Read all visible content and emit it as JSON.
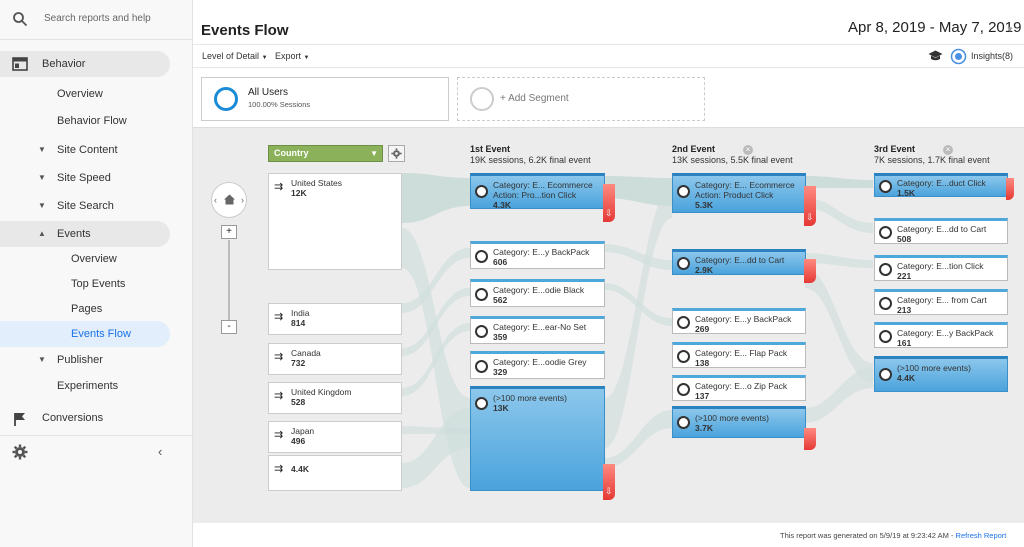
{
  "sidebar": {
    "search_placeholder": "Search reports and help",
    "behavior": "Behavior",
    "overview": "Overview",
    "behavior_flow": "Behavior Flow",
    "site_content": "Site Content",
    "site_speed": "Site Speed",
    "site_search": "Site Search",
    "events": "Events",
    "events_overview": "Overview",
    "top_events": "Top Events",
    "pages": "Pages",
    "events_flow": "Events Flow",
    "publisher": "Publisher",
    "experiments": "Experiments",
    "conversions": "Conversions"
  },
  "header": {
    "title": "Events Flow",
    "date_range": "Apr 8, 2019 - May 7, 2019"
  },
  "toolbar": {
    "level_of_detail": "Level of Detail",
    "export": "Export",
    "insights": "Insights(8)"
  },
  "segments": {
    "segment1_name": "All Users",
    "segment1_sub": "100.00% Sessions",
    "add_segment": "+ Add Segment"
  },
  "flow": {
    "dimension": "Country",
    "col1_title": "1st Event",
    "col1_sub": "19K sessions, 6.2K final event",
    "col2_title": "2nd Event",
    "col2_sub": "13K sessions, 5.5K final event",
    "col3_title": "3rd Event",
    "col3_sub": "7K sessions, 1.7K final event",
    "countries": [
      {
        "name": "United States",
        "value": "12K"
      },
      {
        "name": "India",
        "value": "814"
      },
      {
        "name": "Canada",
        "value": "732"
      },
      {
        "name": "United Kingdom",
        "value": "528"
      },
      {
        "name": "Japan",
        "value": "496"
      },
      {
        "name": "",
        "value": "4.4K"
      }
    ],
    "event1": [
      {
        "name": "Category: E... Ecommerce Action: Pro...tion Click",
        "value": "4.3K"
      },
      {
        "name": "Category: E...y BackPack",
        "value": "606"
      },
      {
        "name": "Category: E...odie Black",
        "value": "562"
      },
      {
        "name": "Category: E...ear-No Set",
        "value": "359"
      },
      {
        "name": "Category: E...oodie Grey",
        "value": "329"
      },
      {
        "name": "(>100 more events)",
        "value": "13K"
      }
    ],
    "event2": [
      {
        "name": "Category: E... Ecommerce Action: Product Click",
        "value": "5.3K"
      },
      {
        "name": "Category: E...dd to Cart",
        "value": "2.9K"
      },
      {
        "name": "Category: E...y BackPack",
        "value": "269"
      },
      {
        "name": "Category: E... Flap Pack",
        "value": "138"
      },
      {
        "name": "Category: E...o Zip Pack",
        "value": "137"
      },
      {
        "name": "(>100 more events)",
        "value": "3.7K"
      }
    ],
    "event3": [
      {
        "name": "Category: E...duct Click",
        "value": "1.5K"
      },
      {
        "name": "Category: E...dd to Cart",
        "value": "508"
      },
      {
        "name": "Category: E...tion Click",
        "value": "221"
      },
      {
        "name": "Category: E... from Cart",
        "value": "213"
      },
      {
        "name": "Category: E...y BackPack",
        "value": "161"
      },
      {
        "name": "(>100 more events)",
        "value": "4.4K"
      }
    ]
  },
  "footer": {
    "generated": "This report was generated on 5/9/19 at 9:23:42 AM -",
    "refresh": "Refresh Report"
  }
}
